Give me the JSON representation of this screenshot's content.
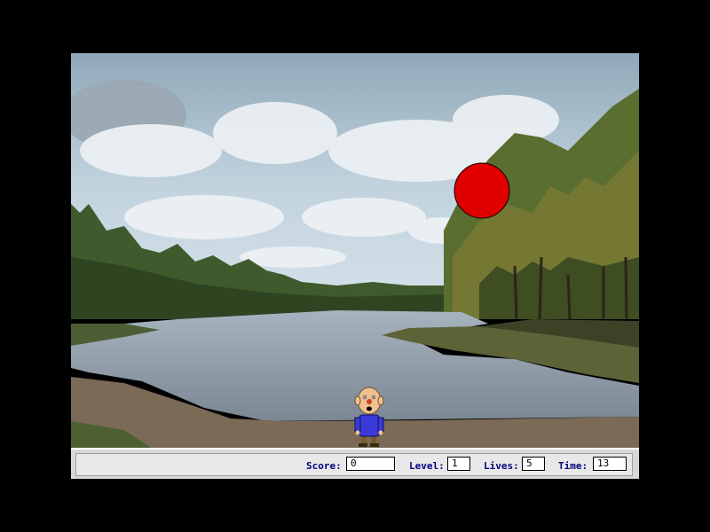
{
  "game": {
    "ball_color": "#e00000",
    "player_icon": "clown-boy-icon"
  },
  "status": {
    "score_label": "Score:",
    "score_value": "0",
    "level_label": "Level:",
    "level_value": "1",
    "lives_label": "Lives:",
    "lives_value": "5",
    "time_label": "Time:",
    "time_value": "13"
  }
}
